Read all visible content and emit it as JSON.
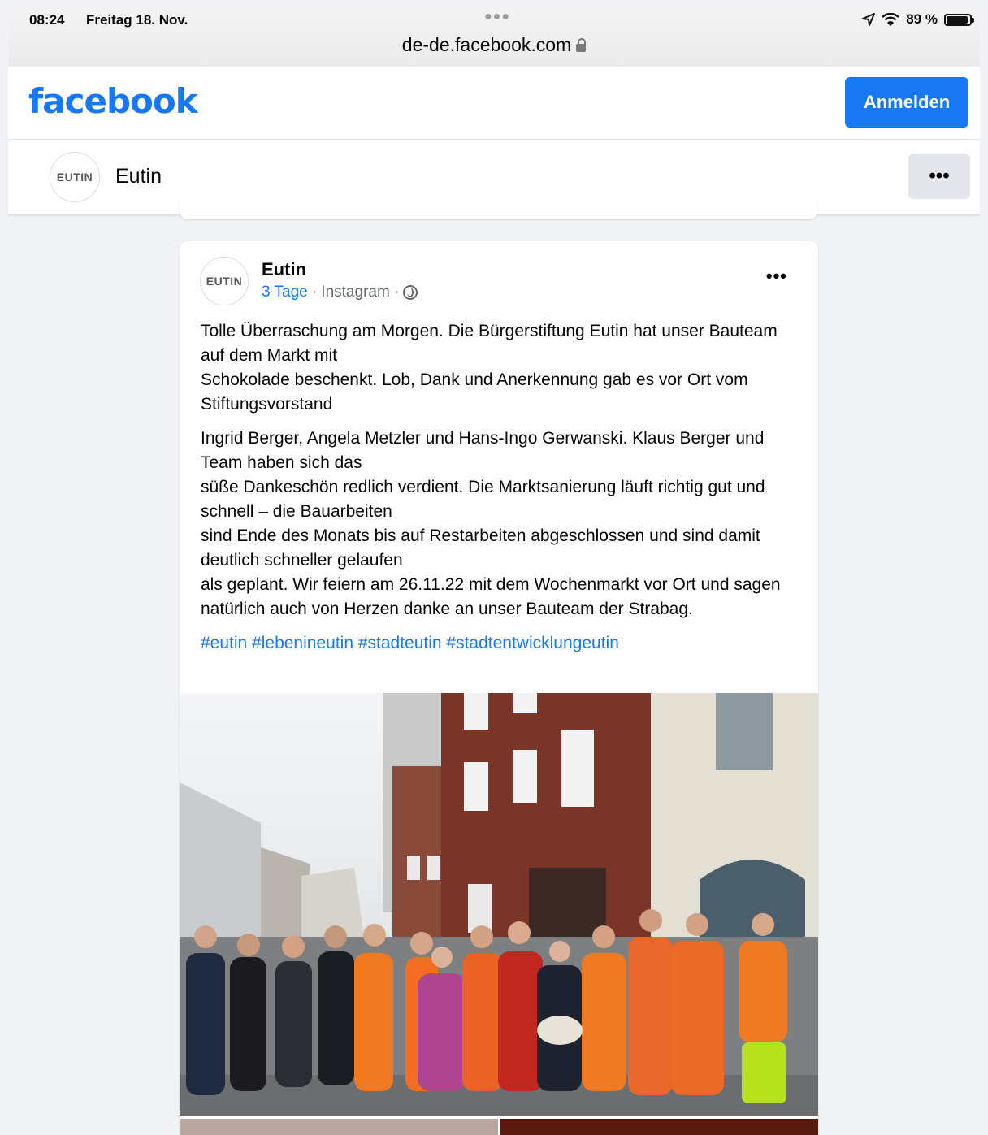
{
  "status": {
    "time": "08:24",
    "date": "Freitag 18. Nov.",
    "url": "de-de.facebook.com",
    "battery": "89 %"
  },
  "header": {
    "logo": "facebook",
    "login_label": "Anmelden"
  },
  "page": {
    "avatar_text": "EUTIN",
    "name": "Eutin",
    "more_label": "•••"
  },
  "post": {
    "avatar_text": "EUTIN",
    "author": "Eutin",
    "time": "3 Tage",
    "source": " · Instagram · ",
    "more_label": "•••",
    "paragraph1_line1": "Tolle Überraschung am Morgen. Die Bürgerstiftung Eutin hat unser Bauteam auf dem Markt mit",
    "paragraph1_line2": "Schokolade beschenkt. Lob, Dank und Anerkennung gab es vor Ort vom Stiftungsvorstand",
    "paragraph2_line1": "Ingrid Berger, Angela Metzler und Hans-Ingo Gerwanski. Klaus Berger und Team haben sich das",
    "paragraph2_line2": "süße Dankeschön redlich verdient. Die Marktsanierung läuft richtig gut und schnell – die Bauarbeiten",
    "paragraph2_line3": "sind Ende des Monats bis auf Restarbeiten abgeschlossen und sind damit deutlich schneller gelaufen",
    "paragraph2_line4": "als geplant. Wir feiern am 26.11.22 mit dem Wochenmarkt vor Ort und sagen natürlich auch von Herzen danke an unser Bauteam der Strabag.",
    "hashtags": "#eutin #lebenineutin #stadteutin #stadtentwicklungeutin"
  },
  "colors": {
    "brand": "#1877f2",
    "background": "#f0f2f5",
    "secondary_text": "#65676b"
  },
  "icons": [
    "lock-icon",
    "location-arrow-icon",
    "wifi-icon",
    "battery-icon",
    "globe-icon",
    "more-icon"
  ]
}
